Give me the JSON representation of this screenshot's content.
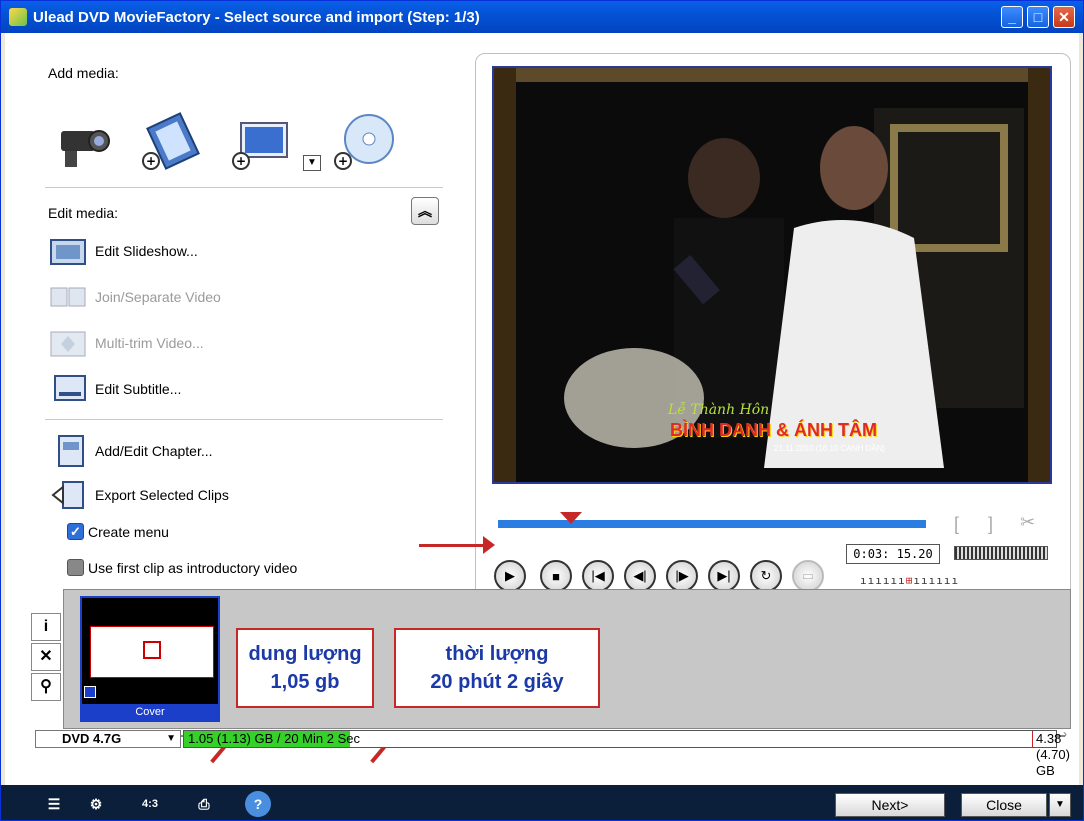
{
  "window": {
    "title": "Ulead DVD MovieFactory - Select source and import (Step: 1/3)"
  },
  "left": {
    "add_media_label": "Add media:",
    "add_media_icons": [
      "camcorder-icon",
      "video-file-icon",
      "image-file-icon",
      "disc-icon"
    ],
    "edit_media_label": "Edit media:",
    "items": [
      {
        "label": "Edit Slideshow...",
        "enabled": true,
        "icon": "slideshow-icon"
      },
      {
        "label": "Join/Separate Video",
        "enabled": false,
        "icon": "join-video-icon"
      },
      {
        "label": "Multi-trim Video...",
        "enabled": false,
        "icon": "multi-trim-icon"
      },
      {
        "label": "Edit Subtitle...",
        "enabled": true,
        "icon": "subtitle-icon"
      },
      {
        "label": "Add/Edit Chapter...",
        "enabled": true,
        "icon": "chapter-icon"
      },
      {
        "label": "Export Selected Clips",
        "enabled": true,
        "icon": "export-icon"
      }
    ],
    "create_menu": {
      "label": "Create menu",
      "checked": true
    },
    "first_clip": {
      "label": "Use first clip as introductory video",
      "checked": false
    }
  },
  "preview": {
    "video_text_line1": "Lễ Thành Hôn",
    "video_text_line2": "BÌNH DANH & ÁNH TÂM",
    "video_text_line3": "21.11.2010 (16.10 CANH DẦN)",
    "timecode": "0:03: 15.20"
  },
  "thumbnail": {
    "caption": "Cover"
  },
  "annotations": {
    "size_line1": "dung lượng",
    "size_line2": "1,05 gb",
    "duration_line1": "thời lượng",
    "duration_line2": "20 phút 2 giây"
  },
  "status": {
    "disc": "DVD 4.7G",
    "used": "1.05 (1.13) GB / 20 Min 2 Sec",
    "remaining": "4.38 (4.70) GB",
    "used_fraction": 0.19
  },
  "buttons": {
    "next": "Next>",
    "close": "Close"
  },
  "colors": {
    "title_bar": "#0453d6",
    "annotation_border": "#c62828",
    "annotation_text": "#1b3aa8",
    "capacity_fill": "#35d12a"
  }
}
